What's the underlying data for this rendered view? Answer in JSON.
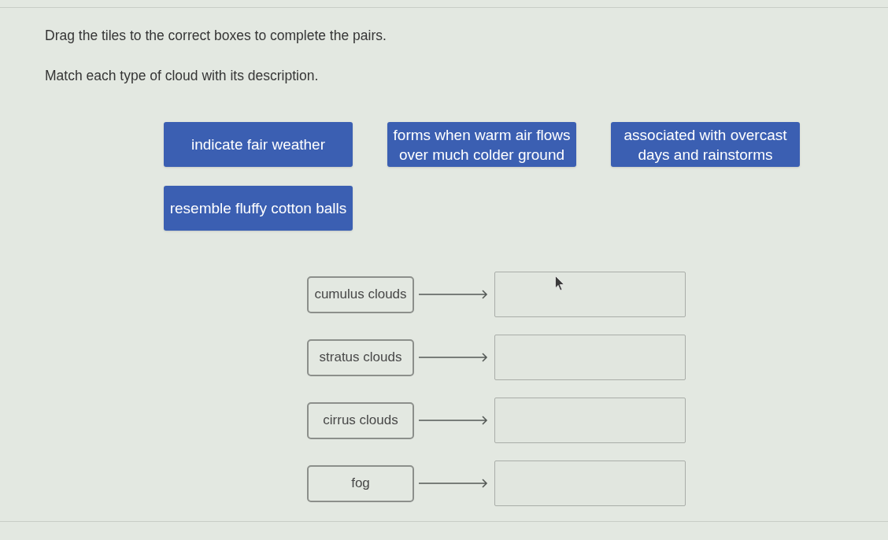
{
  "instructions": [
    "Drag the tiles to the correct boxes to complete the pairs.",
    "Match each type of cloud with its description."
  ],
  "tiles": [
    {
      "text": "indicate fair weather"
    },
    {
      "text": "forms when warm air flows over much colder ground"
    },
    {
      "text": "associated with overcast days and rainstorms"
    },
    {
      "text": "resemble fluffy cotton balls"
    }
  ],
  "pairs": [
    {
      "term": "cumulus clouds"
    },
    {
      "term": "stratus clouds"
    },
    {
      "term": "cirrus clouds"
    },
    {
      "term": "fog"
    }
  ]
}
